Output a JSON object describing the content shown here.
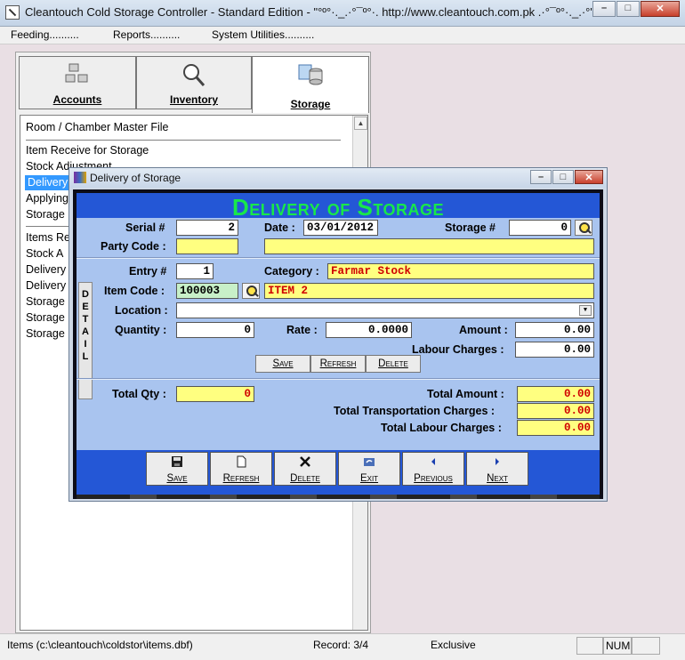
{
  "window": {
    "title": "Cleantouch Cold Storage Controller - Standard Edition  -  \"°º°·._.·°¯º°·. http://www.cleantouch.com.pk .·°¯º°·._.·°\""
  },
  "menu": [
    "Feeding..........",
    "Reports..........",
    "System Utilities.........."
  ],
  "tabs": [
    {
      "label": "Accounts",
      "icon": "accounts-icon"
    },
    {
      "label": "Inventory",
      "icon": "magnifier-icon"
    },
    {
      "label": "Storage",
      "icon": "storage-icon"
    }
  ],
  "list": [
    "Room / Chamber Master File",
    "Item Receive for Storage",
    "Stock Adjustment",
    "Delivery",
    "Applying",
    "Storage",
    "Items Re",
    "Stock A",
    "Delivery",
    "Delivery",
    "Storage",
    "Storage",
    "Storage"
  ],
  "dialog": {
    "title": "Delivery of Storage",
    "heading": "Delivery of Storage",
    "labels": {
      "serial": "Serial #",
      "date": "Date :",
      "storage": "Storage #",
      "party_code": "Party Code :",
      "entry": "Entry #",
      "category": "Category :",
      "item_code": "Item Code :",
      "location": "Location :",
      "quantity": "Quantity :",
      "rate": "Rate :",
      "amount": "Amount :",
      "labour_charges": "Labour Charges :",
      "total_qty": "Total Qty :",
      "total_amount": "Total Amount :",
      "total_transport": "Total Transportation Charges :",
      "total_labour": "Total Labour Charges :",
      "detail": "D\nE\nT\nA\nI\nL"
    },
    "values": {
      "serial": "2",
      "date": "03/01/2012",
      "storage": "0",
      "party_code": "",
      "party_name": "",
      "entry": "1",
      "category": "Farmar Stock",
      "item_code": "100003",
      "item_name": "ITEM 2",
      "location": "",
      "quantity": "0",
      "rate": "0.0000",
      "amount": "0.00",
      "labour_charges": "0.00",
      "total_qty": "0",
      "total_amount": "0.00",
      "total_transport": "0.00",
      "total_labour": "0.00"
    },
    "detail_buttons": [
      "Save",
      "Refresh",
      "Delete"
    ],
    "toolbar": [
      {
        "label": "Save",
        "icon": "floppy-icon"
      },
      {
        "label": "Refresh",
        "icon": "page-icon"
      },
      {
        "label": "Delete",
        "icon": "x-icon"
      },
      {
        "label": "Exit",
        "icon": "exit-icon"
      },
      {
        "label": "Previous",
        "icon": "left-arrow-icon"
      },
      {
        "label": "Next",
        "icon": "right-arrow-icon"
      }
    ]
  },
  "status": {
    "path": "Items (c:\\cleantouch\\coldstor\\items.dbf)",
    "record": "Record: 3/4",
    "mode": "Exclusive",
    "num": "NUM"
  }
}
